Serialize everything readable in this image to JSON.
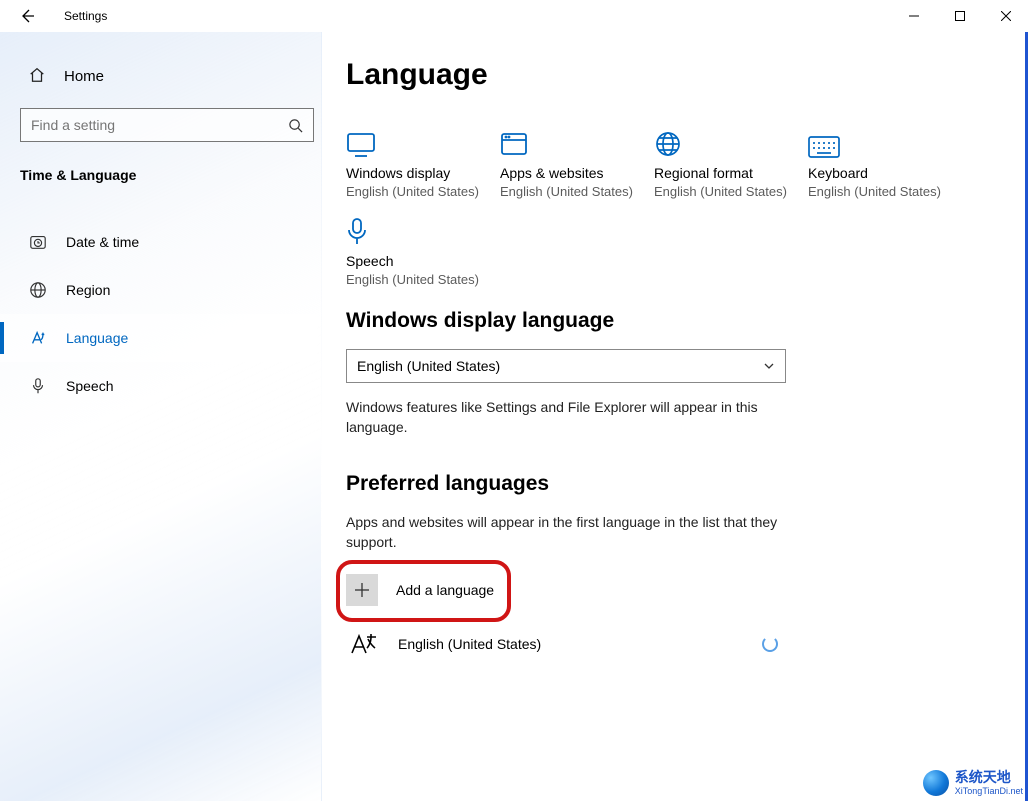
{
  "window": {
    "title": "Settings"
  },
  "sidebar": {
    "home": "Home",
    "search_placeholder": "Find a setting",
    "category": "Time & Language",
    "items": [
      {
        "label": "Date & time",
        "icon": "clock"
      },
      {
        "label": "Region",
        "icon": "globe"
      },
      {
        "label": "Language",
        "icon": "a-letter"
      },
      {
        "label": "Speech",
        "icon": "microphone"
      }
    ],
    "selected_index": 2
  },
  "page": {
    "title": "Language",
    "tiles": [
      {
        "title": "Windows display",
        "sub": "English (United States)",
        "icon": "monitor"
      },
      {
        "title": "Apps & websites",
        "sub": "English (United States)",
        "icon": "browser"
      },
      {
        "title": "Regional format",
        "sub": "English (United States)",
        "icon": "globe"
      },
      {
        "title": "Keyboard",
        "sub": "English (United States)",
        "icon": "keyboard"
      },
      {
        "title": "Speech",
        "sub": "English (United States)",
        "icon": "microphone"
      }
    ],
    "display_lang_section": "Windows display language",
    "display_lang_selected": "English (United States)",
    "display_lang_note": "Windows features like Settings and File Explorer will appear in this language.",
    "preferred_section": "Preferred languages",
    "preferred_note": "Apps and websites will appear in the first language in the list that they support.",
    "add_language": "Add a language",
    "preferred_items": [
      {
        "label": "English (United States)"
      }
    ]
  },
  "watermark": {
    "line1": "系统天地",
    "line2": "XiTongTianDi.net"
  }
}
